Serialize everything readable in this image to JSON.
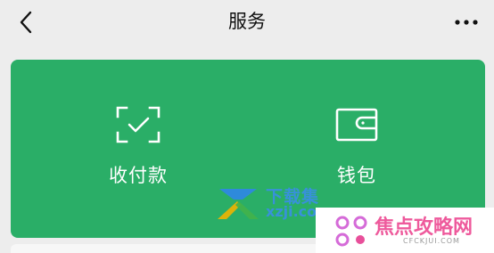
{
  "nav": {
    "title": "服务",
    "back_icon": "chevron-left-icon",
    "more_icon": "ellipsis-icon"
  },
  "card": {
    "background": "#2aae67",
    "services": [
      {
        "label": "收付款",
        "icon": "scan-check-icon"
      },
      {
        "label": "钱包",
        "icon": "wallet-icon"
      }
    ]
  },
  "watermarks": {
    "xzji_title": "下载集",
    "xzji_url": "xzji.com",
    "jiaodian_title": "焦点攻略网",
    "jiaodian_url": "CFCKJUI.COM"
  }
}
